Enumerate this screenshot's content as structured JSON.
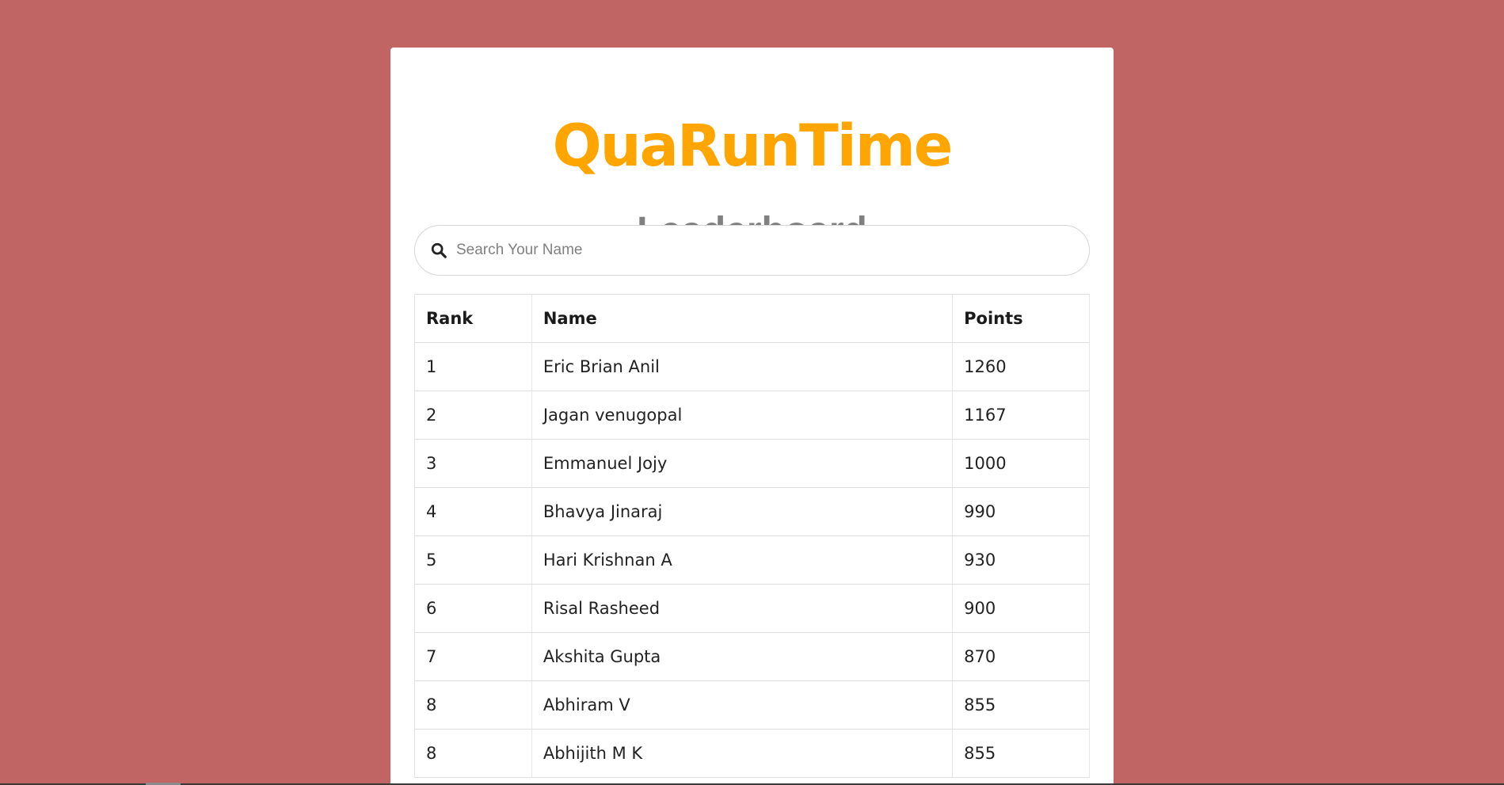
{
  "app": {
    "brand": "QuaRunTime",
    "title": "Leaderboard"
  },
  "search": {
    "placeholder": "Search Your Name",
    "value": ""
  },
  "table": {
    "headers": [
      "Rank",
      "Name",
      "Points"
    ],
    "rows": [
      [
        "1",
        "Eric Brian Anil",
        "1260"
      ],
      [
        "2",
        "Jagan venugopal",
        "1167"
      ],
      [
        "3",
        "Emmanuel Jojy",
        "1000"
      ],
      [
        "4",
        "Bhavya Jinaraj",
        "990"
      ],
      [
        "5",
        "Hari Krishnan A",
        "930"
      ],
      [
        "6",
        "Risal Rasheed",
        "900"
      ],
      [
        "7",
        "Akshita Gupta",
        "870"
      ],
      [
        "8",
        "Abhiram V",
        "855"
      ],
      [
        "8",
        "Abhijith M K",
        "855"
      ]
    ]
  },
  "colors": {
    "background": "#c06464",
    "brand": "#ffa500",
    "title": "#808080"
  },
  "icons": {
    "search": "search-icon"
  }
}
